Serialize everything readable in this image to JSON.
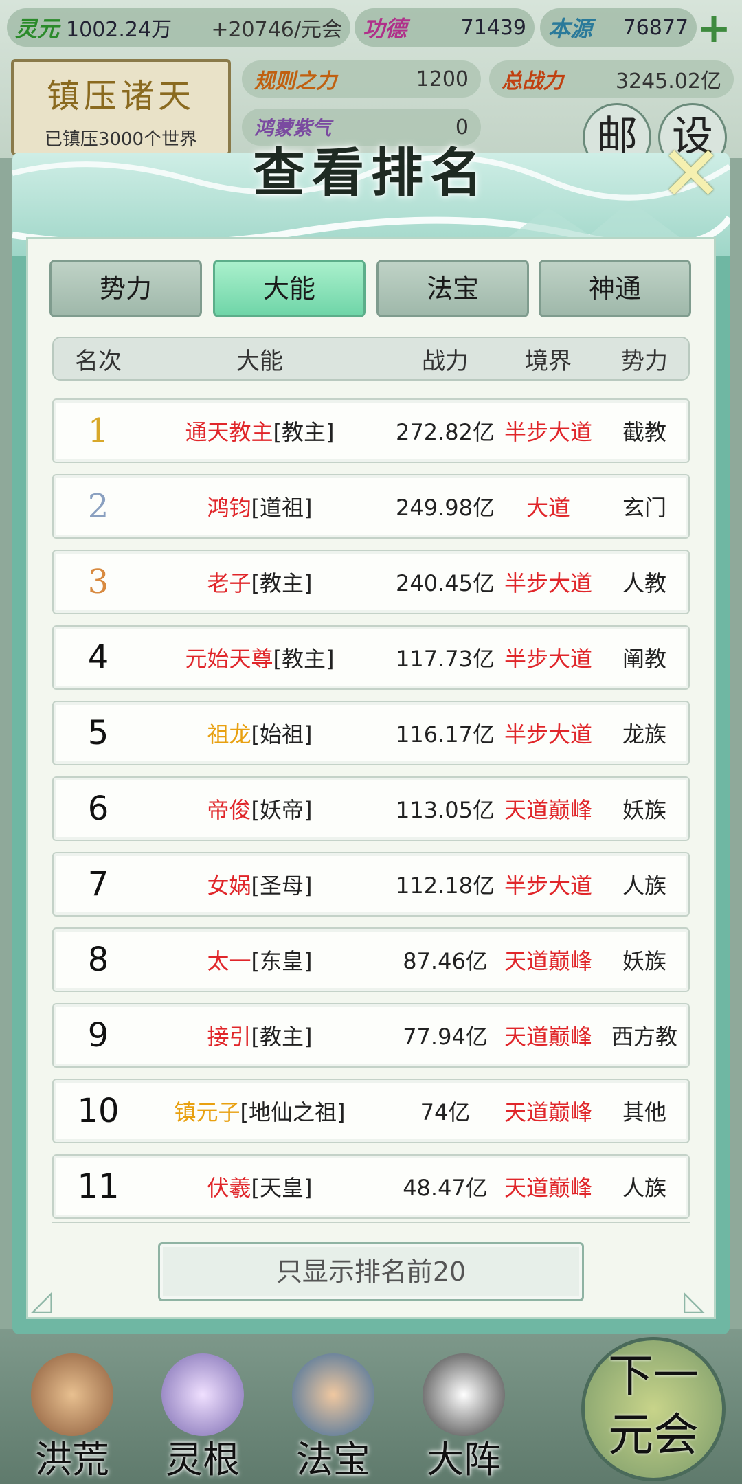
{
  "resources": {
    "lingyuan_label": "灵元",
    "lingyuan_value": "1002.24万",
    "lingyuan_rate": "+20746/元会",
    "gongde_label": "功德",
    "gongde_value": "71439",
    "benyuan_label": "本源",
    "benyuan_value": "76877"
  },
  "seal": {
    "title": "镇压诸天",
    "subtitle": "已镇压3000个世界"
  },
  "stats": {
    "rule_label": "规则之力",
    "rule_value": "1200",
    "total_power_label": "总战力",
    "total_power_value": "3245.02亿",
    "hongmeng_label": "鸿蒙紫气",
    "hongmeng_value": "0"
  },
  "side_buttons": {
    "mail": "邮",
    "settings": "设"
  },
  "modal": {
    "title": "查看排名",
    "tabs": [
      {
        "label": "势力"
      },
      {
        "label": "大能"
      },
      {
        "label": "法宝"
      },
      {
        "label": "神通"
      }
    ],
    "headers": {
      "rank": "名次",
      "name": "大能",
      "power": "战力",
      "realm": "境界",
      "faction": "势力"
    },
    "rows": [
      {
        "rank": "1",
        "name": "通天教主",
        "title": "[教主]",
        "power": "272.82亿",
        "realm": "半步大道",
        "faction": "截教"
      },
      {
        "rank": "2",
        "name": "鸿钧",
        "title": "[道祖]",
        "power": "249.98亿",
        "realm": "大道",
        "faction": "玄门"
      },
      {
        "rank": "3",
        "name": "老子",
        "title": "[教主]",
        "power": "240.45亿",
        "realm": "半步大道",
        "faction": "人教"
      },
      {
        "rank": "4",
        "name": "元始天尊",
        "title": "[教主]",
        "power": "117.73亿",
        "realm": "半步大道",
        "faction": "阐教"
      },
      {
        "rank": "5",
        "name": "祖龙",
        "title": "[始祖]",
        "power": "116.17亿",
        "realm": "半步大道",
        "faction": "龙族"
      },
      {
        "rank": "6",
        "name": "帝俊",
        "title": "[妖帝]",
        "power": "113.05亿",
        "realm": "天道巅峰",
        "faction": "妖族"
      },
      {
        "rank": "7",
        "name": "女娲",
        "title": "[圣母]",
        "power": "112.18亿",
        "realm": "半步大道",
        "faction": "人族"
      },
      {
        "rank": "8",
        "name": "太一",
        "title": "[东皇]",
        "power": "87.46亿",
        "realm": "天道巅峰",
        "faction": "妖族"
      },
      {
        "rank": "9",
        "name": "接引",
        "title": "[教主]",
        "power": "77.94亿",
        "realm": "天道巅峰",
        "faction": "西方教"
      },
      {
        "rank": "10",
        "name": "镇元子",
        "title": "[地仙之祖]",
        "power": "74亿",
        "realm": "天道巅峰",
        "faction": "其他"
      },
      {
        "rank": "11",
        "name": "伏羲",
        "title": "[天皇]",
        "power": "48.47亿",
        "realm": "天道巅峰",
        "faction": "人族"
      }
    ],
    "filter_button": "只显示排名前20"
  },
  "bottom_nav": [
    {
      "label": "洪荒"
    },
    {
      "label": "灵根"
    },
    {
      "label": "法宝"
    },
    {
      "label": "大阵"
    }
  ],
  "next_button": {
    "line1": "下一",
    "line2": "元会"
  },
  "colors": {
    "accent_green": "#6fd5a8",
    "name_red": "#e0262a",
    "name_orange": "#e8a010",
    "rank_gold": "#d8a82a"
  }
}
